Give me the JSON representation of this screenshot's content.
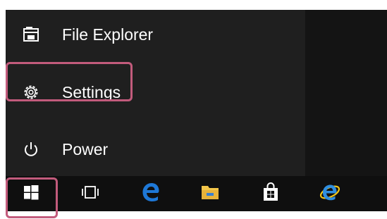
{
  "start_menu": {
    "items": [
      {
        "label": "File Explorer",
        "icon": "file-explorer-icon"
      },
      {
        "label": "Settings",
        "icon": "gear-icon",
        "highlighted": true
      },
      {
        "label": "Power",
        "icon": "power-icon"
      }
    ]
  },
  "taskbar": {
    "buttons": [
      {
        "icon": "windows-start-icon",
        "highlighted": true
      },
      {
        "icon": "task-view-icon"
      },
      {
        "icon": "edge-icon"
      },
      {
        "icon": "folder-icon"
      },
      {
        "icon": "store-icon"
      },
      {
        "icon": "internet-explorer-icon"
      }
    ]
  },
  "colors": {
    "highlight": "#c25b7c",
    "menu_bg": "#1f1f1f",
    "taskbar_bg": "#0f0f0f",
    "edge_blue": "#1e78d7",
    "folder_yellow": "#f4c64a"
  }
}
